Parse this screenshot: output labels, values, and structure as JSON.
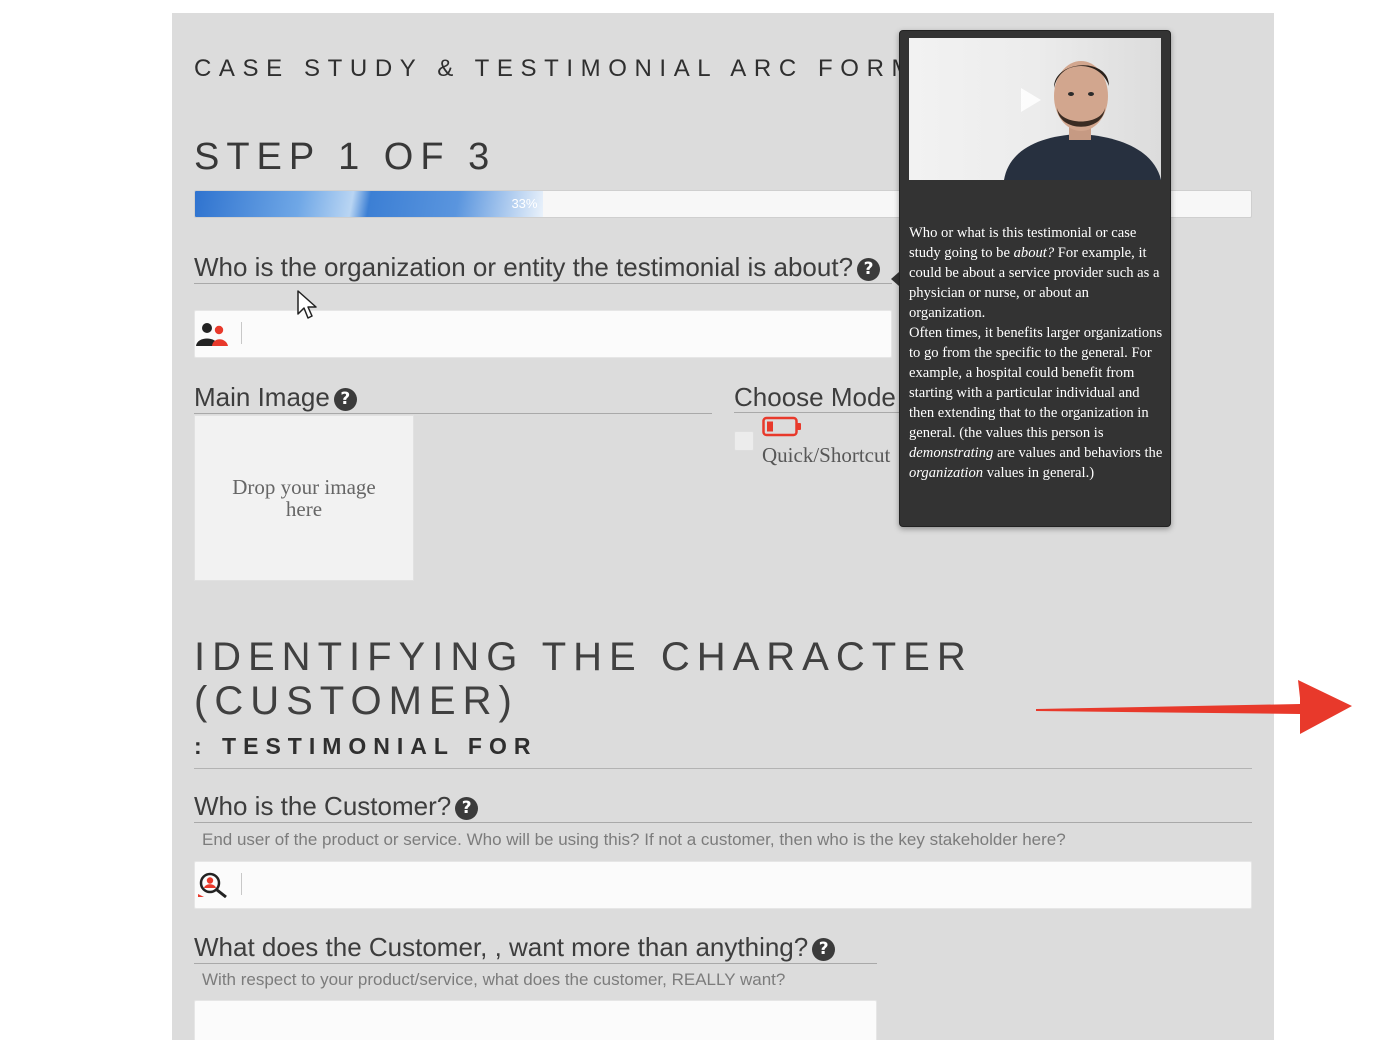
{
  "form": {
    "title": "CASE STUDY & TESTIMONIAL ARC FORM",
    "step": "STEP 1 OF 3",
    "progress": {
      "percent": 33,
      "label": "33%"
    }
  },
  "fields": {
    "organization": {
      "label": "Who is the organization or entity the testimonial is about?",
      "value": ""
    },
    "main_image": {
      "label": "Main Image",
      "dropzone_text": "Drop your image here"
    },
    "mode": {
      "label": "Choose Mode",
      "option_label": "Quick/Shortcut"
    }
  },
  "section": {
    "title": "IDENTIFYING THE CHARACTER (CUSTOMER)",
    "subtitle": ": TESTIMONIAL FOR"
  },
  "customer_fields": {
    "customer": {
      "label": "Who is the Customer?",
      "hint": "End user of the product or service. Who will be using this? If not a customer, then who is the key stakeholder here?",
      "value": ""
    },
    "desire": {
      "label": "What does the Customer, , want more than anything?",
      "hint": "With respect to your product/service, what does the customer, REALLY want?",
      "value": ""
    }
  },
  "tooltip": {
    "p1_a": "Who or what is this testimonial or case study going to be ",
    "p1_em": "about?",
    "p1_b": " For example, it could be about a service provider such as a physician or nurse, or about an organization.",
    "p2_a": "Often times, it benefits larger organizations to go from the specific to the general. For example, a hospital could benefit from starting with a particular individual and then extending that to the organization in general.  (the values this person is ",
    "p2_em1": "demonstrating",
    "p2_b": " are values and behaviors the ",
    "p2_em2": "organization",
    "p2_c": " values in general.)"
  },
  "icons": {
    "help": "question-circle-icon",
    "organization": "users-icon",
    "customer": "user-search-icon",
    "mode": "battery-low-icon",
    "video": "play-icon",
    "annotation": "red-arrow-icon"
  },
  "colors": {
    "panel": "#dcdcdc",
    "tooltip": "#333333",
    "accent_red": "#e8392b",
    "progress_blue": "#3c7fd4"
  }
}
